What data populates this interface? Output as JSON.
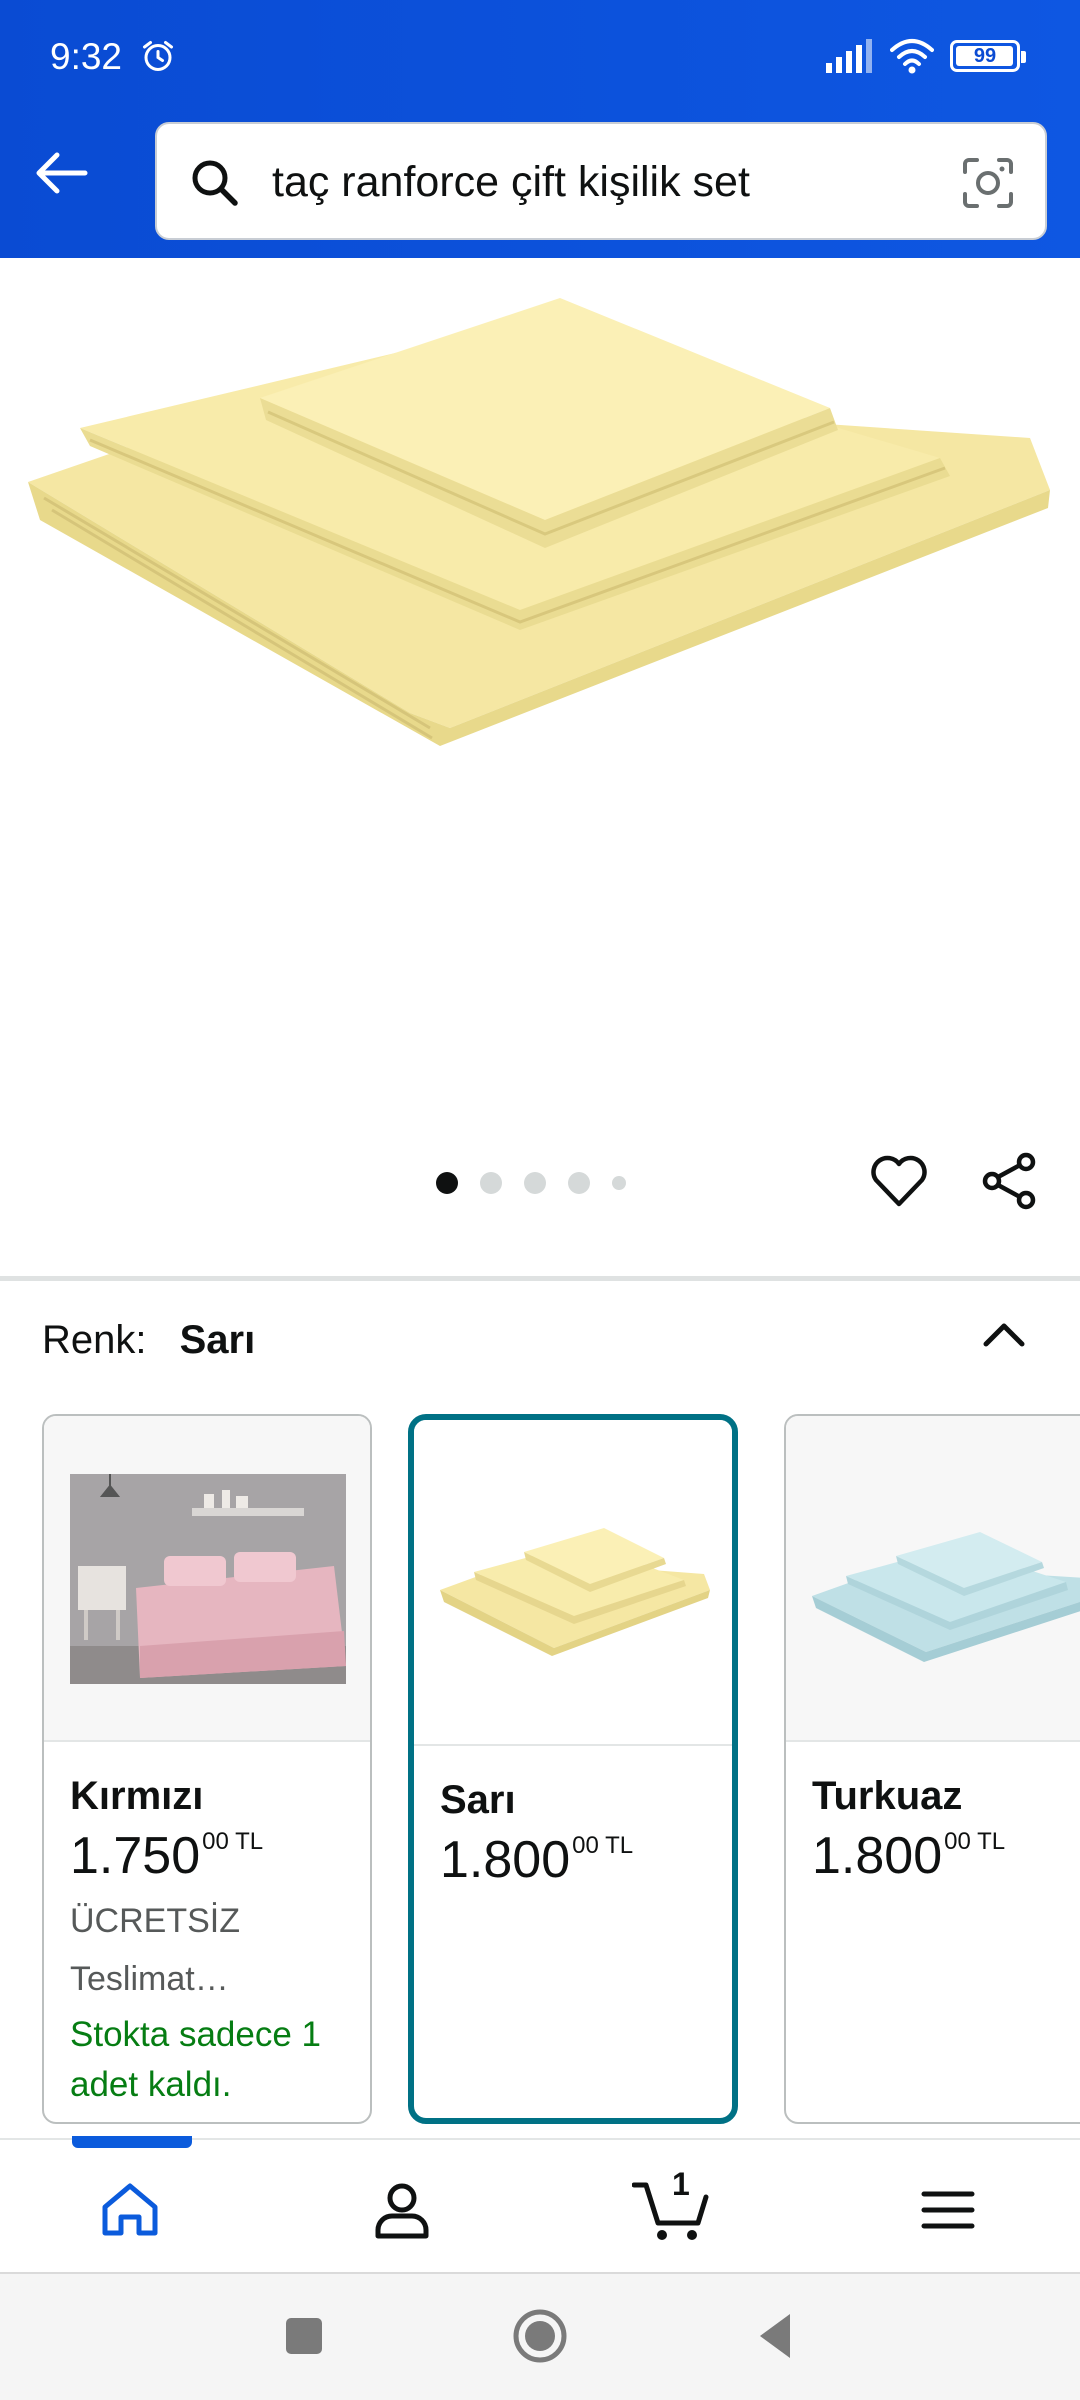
{
  "status_bar": {
    "time": "9:32",
    "battery": "99"
  },
  "search": {
    "query": "taç ranforce çift kişilik set"
  },
  "product": {
    "image_alt": "yellow folded bedsheet set"
  },
  "gallery": {
    "dot_count": 5,
    "active_index": 0
  },
  "color_selector": {
    "label": "Renk:",
    "selected": "Sarı",
    "options": [
      {
        "name": "Kırmızı",
        "price_main": "1.750",
        "price_frac": "00",
        "currency": "TL",
        "delivery": "ÜCRETSİZ",
        "delivery2": "Teslimat…",
        "stock": "Stokta sadece 1 adet kaldı."
      },
      {
        "name": "Sarı",
        "price_main": "1.800",
        "price_frac": "00",
        "currency": "TL"
      },
      {
        "name": "Turkuaz",
        "price_main": "1.800",
        "price_frac": "00",
        "currency": "TL"
      }
    ]
  },
  "bottom_nav": {
    "cart_count": "1"
  },
  "colors": {
    "header_blue": "#0a4bd3",
    "selected_border": "#007185",
    "stock_green": "#067d13",
    "nav_active": "#0b5bdc"
  }
}
